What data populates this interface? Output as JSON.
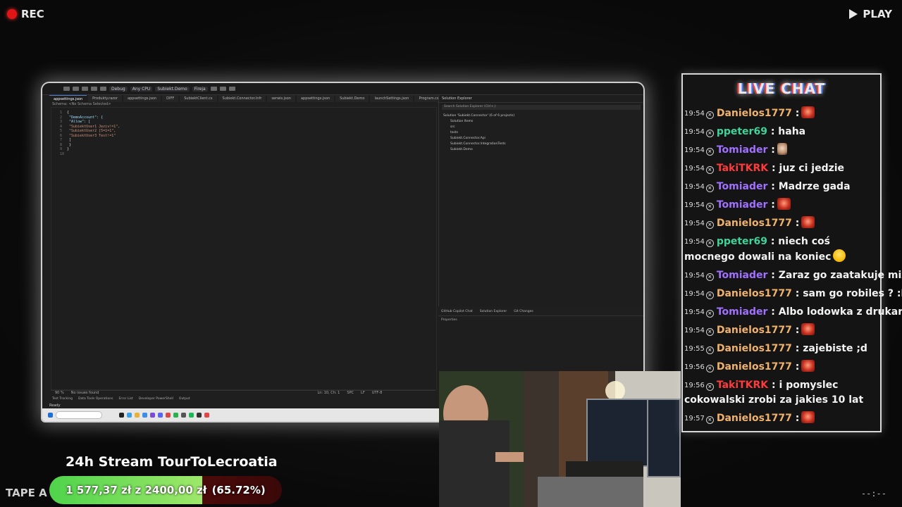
{
  "overlay": {
    "rec_label": "REC",
    "play_label": "PLAY",
    "tape_label": "TAPE A",
    "corner_dots": "--:--"
  },
  "ide": {
    "toolbar": {
      "config": "Debug",
      "platform": "Any CPU",
      "startup": "Subiekt.Demo",
      "run": "Fireja"
    },
    "tabs": [
      "appsettings.json",
      "Produkty.razor",
      "appsettings.json",
      "DIFF",
      "SubiektClient.cs",
      "Subiekt.Connector.Infr",
      "serwis.json",
      "appsettings.json",
      "Subiekt.Demo",
      "launchSettings.json",
      "Program.cs"
    ],
    "breadcrumb": "Schema: <No Schema Selected>",
    "code_lines": [
      {
        "n": "1",
        "text": "{"
      },
      {
        "n": "2",
        "text": "  \"DemoAccount\": {"
      },
      {
        "n": "3",
        "text": "    \"Allow\": ["
      },
      {
        "n": "4",
        "text": "      \"SubiektUser1 Jeziv!=1\","
      },
      {
        "n": "5",
        "text": "      \"SubiektUser2 [5=1=1\","
      },
      {
        "n": "6",
        "text": "      \"SubiektUser3 Test!=1\""
      },
      {
        "n": "7",
        "text": "    ]"
      },
      {
        "n": "8",
        "text": "  }"
      },
      {
        "n": "9",
        "text": "}"
      },
      {
        "n": "10",
        "text": ""
      }
    ],
    "status_zoom": "90 %",
    "status_issues": "No issues found",
    "status_pos": "Ln: 10, Ch: 1",
    "status_enc": "SPC",
    "status_eol": "LF",
    "status_utf": "UTF-8",
    "bottom_tabs": [
      "Test Tracking",
      "Data Tools Operations",
      "Error List",
      "Developer PowerShell",
      "Output"
    ],
    "ready": "Ready",
    "solution_explorer": {
      "title": "Solution Explorer",
      "search": "Search Solution Explorer (Ctrl+;)",
      "tree": [
        "Solution 'Subiekt.Connector' (6 of 6 projects)",
        "Solution Items",
        "src",
        "tests",
        "Subiekt.Connector.Api",
        "Subiekt.Connector.IntegrationTests",
        "Subiekt.Demo"
      ]
    },
    "side_tabs": [
      "GitHub Copilot Chat",
      "Solution Explorer",
      "Git Changes"
    ],
    "properties_title": "Properties"
  },
  "chat": {
    "title": "LIVE CHAT",
    "messages": [
      {
        "time": "19:54",
        "user": "Danielos1777",
        "color": "#f0b26b",
        "text": " :",
        "emote": "red"
      },
      {
        "time": "19:54",
        "user": "ppeter69",
        "color": "#3fd39a",
        "text": " : haha",
        "emote": ""
      },
      {
        "time": "19:54",
        "user": "Tomiader",
        "color": "#a070ff",
        "text": " :",
        "emote": "face"
      },
      {
        "time": "19:54",
        "user": "TakiTKRK",
        "color": "#ff3a3a",
        "text": " : juz ci jedzie",
        "emote": ""
      },
      {
        "time": "19:54",
        "user": "Tomiader",
        "color": "#a070ff",
        "text": " : Madrze gada",
        "emote": ""
      },
      {
        "time": "19:54",
        "user": "Tomiader",
        "color": "#a070ff",
        "text": " :",
        "emote": "red"
      },
      {
        "time": "19:54",
        "user": "Danielos1777",
        "color": "#f0b26b",
        "text": " :",
        "emote": "red"
      },
      {
        "time": "19:54",
        "user": "ppeter69",
        "color": "#3fd39a",
        "text": " : niech coś mocnego dowali na koniec",
        "emote": "smile",
        "wrap": true
      },
      {
        "time": "19:54",
        "user": "Tomiader",
        "color": "#a070ff",
        "text": " : Zaraz go zaatakuje mixer",
        "emote": ""
      },
      {
        "time": "19:54",
        "user": "Danielos1777",
        "color": "#f0b26b",
        "text": " : sam go robiles ? :D",
        "emote": ""
      },
      {
        "time": "19:54",
        "user": "Tomiader",
        "color": "#a070ff",
        "text": " : Albo lodowka z drukarka",
        "emote": ""
      },
      {
        "time": "19:54",
        "user": "Danielos1777",
        "color": "#f0b26b",
        "text": " :",
        "emote": "red"
      },
      {
        "time": "19:55",
        "user": "Danielos1777",
        "color": "#f0b26b",
        "text": " : zajebiste ;d",
        "emote": ""
      },
      {
        "time": "19:56",
        "user": "Danielos1777",
        "color": "#f0b26b",
        "text": " :",
        "emote": "red"
      },
      {
        "time": "19:56",
        "user": "TakiTKRK",
        "color": "#ff3a3a",
        "text": " : i pomyslec cokowalski zrobi za jakies 10 lat",
        "emote": "",
        "wrap": true
      },
      {
        "time": "19:57",
        "user": "Danielos1777",
        "color": "#f0b26b",
        "text": " :",
        "emote": "red"
      }
    ]
  },
  "goal": {
    "title": "24h Stream TourToLecroatia",
    "text": "1 577,37 zł  z  2400,00 zł",
    "percent_label": "(65.72%)",
    "progress": 0.6572
  }
}
